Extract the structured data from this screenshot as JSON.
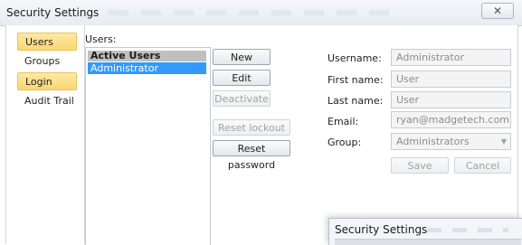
{
  "window": {
    "title": "Security Settings",
    "close_glyph": "✕"
  },
  "nav": {
    "items": [
      {
        "label": "Users",
        "selected": true
      },
      {
        "label": "Groups",
        "selected": false
      },
      {
        "label": "Login",
        "selected": true
      },
      {
        "label": "Audit Trail",
        "selected": false
      }
    ]
  },
  "users": {
    "label": "Users:",
    "group_header": "Active Users",
    "rows": [
      "Administrator"
    ]
  },
  "buttons": {
    "new": "New",
    "edit": "Edit",
    "deactivate": "Deactivate",
    "reset_lockout": "Reset lockout",
    "reset_password": "Reset password",
    "save": "Save",
    "cancel": "Cancel"
  },
  "form": {
    "username_label": "Username:",
    "username_value": "Administrator",
    "firstname_label": "First name:",
    "firstname_value": "User",
    "lastname_label": "Last name:",
    "lastname_value": "User",
    "email_label": "Email:",
    "email_value": "ryan@madgetech.com",
    "group_label": "Group:",
    "group_value": "Administrators"
  },
  "overlay_window": {
    "title": "Security Settings"
  },
  "colors": {
    "selected_nav": "#fbd772",
    "selected_row": "#3399ff",
    "group_header": "#bfbfbf"
  }
}
